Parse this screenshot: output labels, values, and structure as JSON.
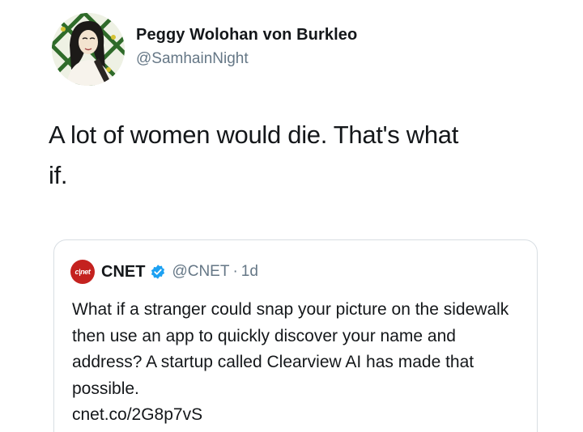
{
  "tweet": {
    "avatar_icon": "profile-avatar-illustration",
    "display_name": "Peggy Wolohan von Burkleo",
    "handle": "@SamhainNight",
    "text_line1": "A lot of women would die. That's what",
    "text_line2": "if."
  },
  "quote": {
    "logo_text": "c|net",
    "name": "CNET",
    "verified_icon": "verified-badge-icon",
    "handle": "@CNET",
    "separator": "·",
    "time": "1d",
    "text": "What if a stranger could snap your picture on the sidewalk then use an app to quickly discover your name and address? A startup called Clearview AI has made that possible.",
    "link": "cnet.co/2G8p7vS"
  },
  "colors": {
    "text": "#14171a",
    "secondary": "#657786",
    "verified": "#1da1f2",
    "cnet_red": "#c4221f",
    "border": "#d8dee3"
  }
}
